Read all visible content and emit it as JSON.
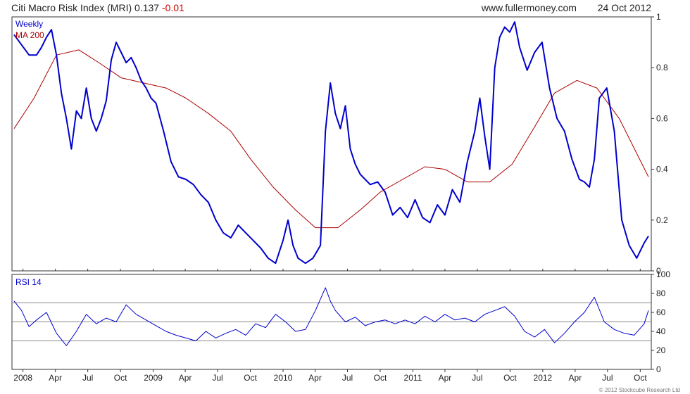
{
  "header": {
    "title": "Citi Macro Risk Index (MRI)",
    "value": "0.137",
    "change": "-0.01",
    "site": "www.fullermoney.com",
    "date": "24 Oct 2012"
  },
  "copyright": "© 2012 Stockcube Research Ltd",
  "colors": {
    "price": "#0000cc",
    "ma": "#aa0000",
    "rsi": "#0000cc",
    "grid": "#333333",
    "refline": "#888888"
  },
  "chart_data": [
    {
      "type": "line",
      "legend_placement": "top-left",
      "ylim": [
        0,
        1
      ],
      "yticks": [
        "0",
        "0.2",
        "0.4",
        "0.6",
        "0.8",
        "1"
      ],
      "x_ticks": [
        "2008",
        "Apr",
        "Jul",
        "Oct",
        "2009",
        "Apr",
        "Jul",
        "Oct",
        "2010",
        "Apr",
        "Jul",
        "Oct",
        "2011",
        "Apr",
        "Jul",
        "Oct",
        "2012",
        "Apr",
        "Jul",
        "Oct"
      ],
      "series": [
        {
          "name": "Weekly",
          "x": [
            "2007-12-07",
            "2007-12-28",
            "2008-01-18",
            "2008-02-08",
            "2008-02-22",
            "2008-03-07",
            "2008-03-21",
            "2008-04-04",
            "2008-04-18",
            "2008-05-02",
            "2008-05-16",
            "2008-05-30",
            "2008-06-13",
            "2008-06-27",
            "2008-07-11",
            "2008-07-25",
            "2008-08-08",
            "2008-08-22",
            "2008-09-05",
            "2008-09-19",
            "2008-10-03",
            "2008-10-17",
            "2008-10-31",
            "2008-11-14",
            "2008-11-28",
            "2008-12-12",
            "2008-12-26",
            "2009-01-09",
            "2009-01-30",
            "2009-02-20",
            "2009-03-13",
            "2009-04-03",
            "2009-04-24",
            "2009-05-15",
            "2009-06-05",
            "2009-06-26",
            "2009-07-17",
            "2009-08-07",
            "2009-08-28",
            "2009-09-18",
            "2009-10-09",
            "2009-10-30",
            "2009-11-20",
            "2009-12-11",
            "2010-01-01",
            "2010-01-15",
            "2010-01-29",
            "2010-02-12",
            "2010-03-05",
            "2010-03-26",
            "2010-04-16",
            "2010-04-30",
            "2010-05-14",
            "2010-05-28",
            "2010-06-11",
            "2010-06-25",
            "2010-07-09",
            "2010-07-23",
            "2010-08-06",
            "2010-08-20",
            "2010-09-03",
            "2010-09-24",
            "2010-10-15",
            "2010-11-05",
            "2010-11-26",
            "2010-12-17",
            "2011-01-07",
            "2011-01-28",
            "2011-02-18",
            "2011-03-11",
            "2011-04-01",
            "2011-04-22",
            "2011-05-13",
            "2011-06-03",
            "2011-06-24",
            "2011-07-08",
            "2011-07-22",
            "2011-08-05",
            "2011-08-19",
            "2011-09-02",
            "2011-09-16",
            "2011-09-30",
            "2011-10-14",
            "2011-10-28",
            "2011-11-18",
            "2011-12-09",
            "2011-12-30",
            "2012-01-20",
            "2012-02-10",
            "2012-03-02",
            "2012-03-23",
            "2012-04-13",
            "2012-04-27",
            "2012-05-11",
            "2012-05-25",
            "2012-06-08",
            "2012-06-29",
            "2012-07-20",
            "2012-08-10",
            "2012-08-31",
            "2012-09-21",
            "2012-10-12",
            "2012-10-24"
          ],
          "values": [
            0.93,
            0.89,
            0.85,
            0.85,
            0.88,
            0.92,
            0.95,
            0.85,
            0.7,
            0.6,
            0.48,
            0.63,
            0.6,
            0.72,
            0.6,
            0.55,
            0.6,
            0.67,
            0.83,
            0.9,
            0.86,
            0.82,
            0.84,
            0.8,
            0.75,
            0.72,
            0.68,
            0.66,
            0.55,
            0.43,
            0.37,
            0.36,
            0.34,
            0.3,
            0.27,
            0.2,
            0.15,
            0.13,
            0.18,
            0.15,
            0.12,
            0.09,
            0.05,
            0.03,
            0.12,
            0.2,
            0.1,
            0.05,
            0.03,
            0.05,
            0.1,
            0.55,
            0.74,
            0.62,
            0.56,
            0.65,
            0.48,
            0.42,
            0.38,
            0.36,
            0.34,
            0.35,
            0.31,
            0.22,
            0.25,
            0.21,
            0.28,
            0.21,
            0.19,
            0.26,
            0.22,
            0.32,
            0.27,
            0.43,
            0.55,
            0.68,
            0.53,
            0.4,
            0.8,
            0.92,
            0.96,
            0.94,
            0.98,
            0.88,
            0.79,
            0.86,
            0.9,
            0.72,
            0.6,
            0.55,
            0.44,
            0.36,
            0.35,
            0.33,
            0.44,
            0.68,
            0.72,
            0.55,
            0.2,
            0.1,
            0.05,
            0.11,
            0.137
          ]
        },
        {
          "name": "MA 200",
          "x": [
            "2007-12-07",
            "2008-02-01",
            "2008-04-04",
            "2008-06-06",
            "2008-08-01",
            "2008-10-03",
            "2008-12-05",
            "2009-02-06",
            "2009-04-03",
            "2009-06-05",
            "2009-08-07",
            "2009-10-02",
            "2009-12-04",
            "2010-02-05",
            "2010-04-02",
            "2010-06-04",
            "2010-08-06",
            "2010-10-01",
            "2010-12-03",
            "2011-02-04",
            "2011-04-01",
            "2011-06-03",
            "2011-08-05",
            "2011-10-07",
            "2011-12-02",
            "2012-02-03",
            "2012-04-06",
            "2012-06-01",
            "2012-08-03",
            "2012-10-24"
          ],
          "values": [
            0.56,
            0.68,
            0.85,
            0.87,
            0.82,
            0.76,
            0.74,
            0.72,
            0.68,
            0.62,
            0.55,
            0.44,
            0.33,
            0.24,
            0.17,
            0.17,
            0.24,
            0.31,
            0.36,
            0.41,
            0.4,
            0.35,
            0.35,
            0.42,
            0.55,
            0.7,
            0.75,
            0.72,
            0.6,
            0.37
          ]
        }
      ]
    },
    {
      "type": "line",
      "ylim": [
        0,
        100
      ],
      "yticks": [
        "0",
        "20",
        "40",
        "60",
        "80",
        "100"
      ],
      "reference_lines": [
        30,
        50,
        70
      ],
      "series": [
        {
          "name": "RSI 14",
          "x": [
            "2007-12-07",
            "2007-12-28",
            "2008-01-18",
            "2008-02-08",
            "2008-03-07",
            "2008-04-04",
            "2008-05-02",
            "2008-05-30",
            "2008-06-27",
            "2008-07-25",
            "2008-08-22",
            "2008-09-19",
            "2008-10-17",
            "2008-11-14",
            "2008-12-12",
            "2009-01-09",
            "2009-02-06",
            "2009-03-06",
            "2009-04-03",
            "2009-05-01",
            "2009-05-29",
            "2009-06-26",
            "2009-07-24",
            "2009-08-21",
            "2009-09-18",
            "2009-10-16",
            "2009-11-13",
            "2009-12-11",
            "2010-01-08",
            "2010-02-05",
            "2010-03-05",
            "2010-04-02",
            "2010-04-30",
            "2010-05-14",
            "2010-05-28",
            "2010-06-25",
            "2010-07-23",
            "2010-08-20",
            "2010-09-17",
            "2010-10-15",
            "2010-11-12",
            "2010-12-10",
            "2011-01-07",
            "2011-02-04",
            "2011-03-04",
            "2011-04-01",
            "2011-04-29",
            "2011-05-27",
            "2011-06-24",
            "2011-07-22",
            "2011-08-19",
            "2011-09-16",
            "2011-10-14",
            "2011-11-11",
            "2011-12-09",
            "2012-01-06",
            "2012-02-03",
            "2012-03-02",
            "2012-03-30",
            "2012-04-27",
            "2012-05-25",
            "2012-06-22",
            "2012-07-20",
            "2012-08-17",
            "2012-09-14",
            "2012-10-12",
            "2012-10-24"
          ],
          "values": [
            72,
            62,
            45,
            52,
            60,
            38,
            25,
            40,
            58,
            48,
            54,
            50,
            68,
            58,
            52,
            46,
            40,
            36,
            33,
            30,
            40,
            33,
            38,
            42,
            36,
            48,
            44,
            58,
            50,
            40,
            42,
            62,
            86,
            72,
            62,
            50,
            55,
            46,
            50,
            52,
            48,
            52,
            48,
            56,
            50,
            58,
            52,
            54,
            50,
            58,
            62,
            66,
            56,
            40,
            34,
            42,
            28,
            38,
            50,
            60,
            76,
            50,
            42,
            38,
            36,
            48,
            62
          ]
        }
      ]
    }
  ]
}
